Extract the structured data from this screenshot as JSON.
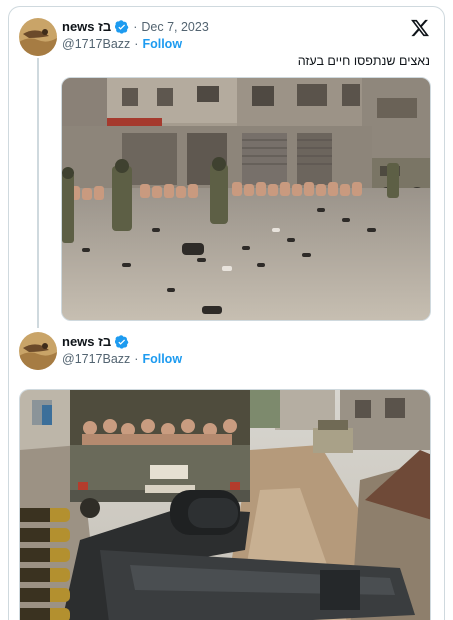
{
  "tweet1": {
    "display_name": "news בז",
    "handle": "@1717Bazz",
    "date": "Dec 7, 2023",
    "separator": "·",
    "follow_label": "Follow",
    "text": "נאצים שנתפסו חיים בעזה"
  },
  "tweet2": {
    "display_name": "news בז",
    "handle": "@1717Bazz",
    "separator": "·",
    "follow_label": "Follow"
  },
  "colors": {
    "accent": "#1d9bf0",
    "verified": "#1d9bf0",
    "secondary_text": "#536471",
    "border": "#cfd9de"
  },
  "icons": {
    "platform": "x-logo-icon",
    "verified": "verified-badge-icon"
  }
}
